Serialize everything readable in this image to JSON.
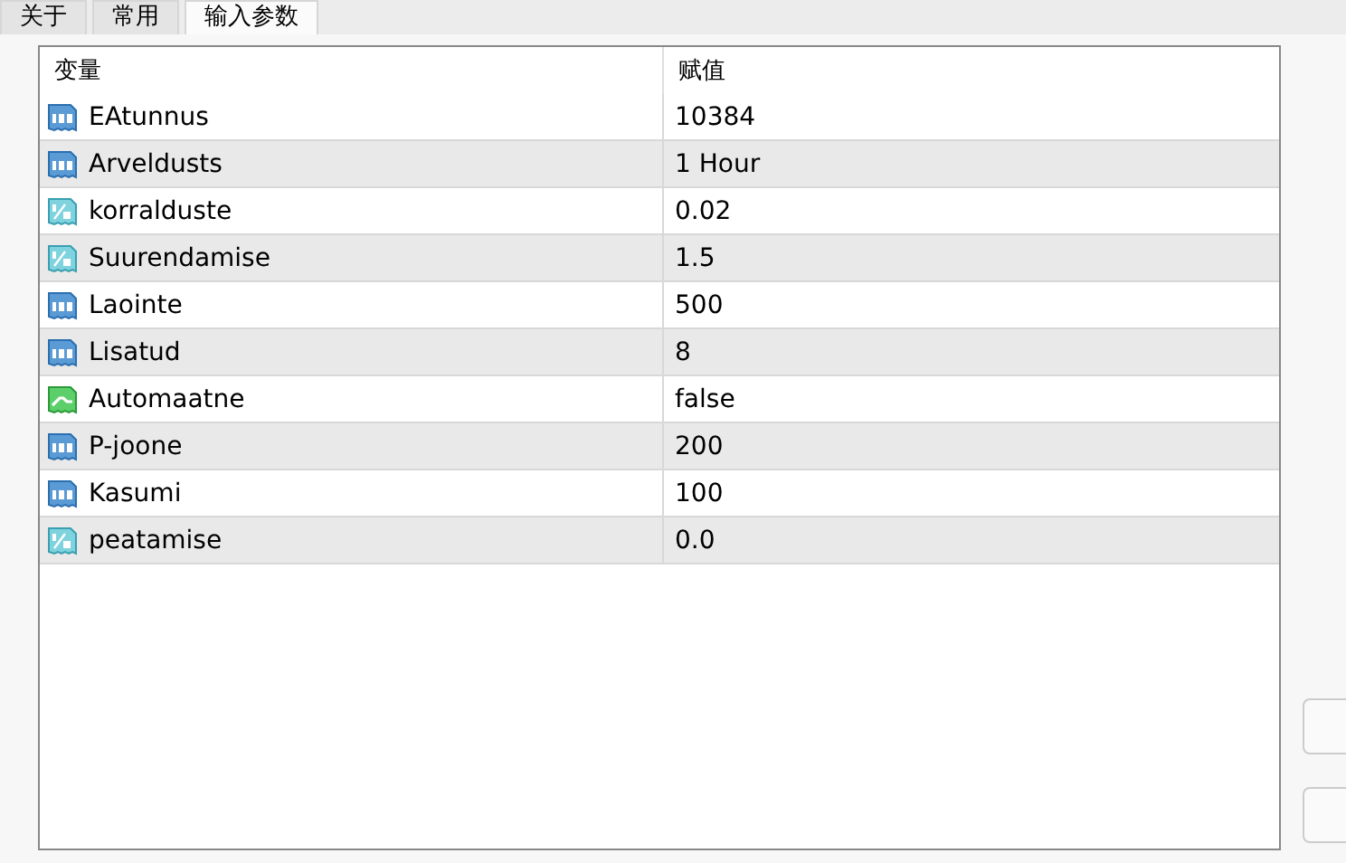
{
  "tabs": [
    {
      "label": "关于",
      "selected": false
    },
    {
      "label": "常用",
      "selected": false
    },
    {
      "label": "输入参数",
      "selected": true
    }
  ],
  "table": {
    "columns": [
      "变量",
      "赋值"
    ],
    "rows": [
      {
        "kind": "int",
        "name": "EAtunnus",
        "value": "10384"
      },
      {
        "kind": "int",
        "name": "Arveldusts",
        "value": "1 Hour"
      },
      {
        "kind": "double",
        "name": "korralduste",
        "value": "0.02"
      },
      {
        "kind": "double",
        "name": "Suurendamise",
        "value": "1.5"
      },
      {
        "kind": "int",
        "name": "Laointe",
        "value": "500"
      },
      {
        "kind": "int",
        "name": "Lisatud",
        "value": "8"
      },
      {
        "kind": "bool",
        "name": "Automaatne",
        "value": "false"
      },
      {
        "kind": "int",
        "name": "P-joone",
        "value": "200"
      },
      {
        "kind": "int",
        "name": "Kasumi",
        "value": "100"
      },
      {
        "kind": "double",
        "name": "peatamise",
        "value": "0.0"
      }
    ]
  }
}
